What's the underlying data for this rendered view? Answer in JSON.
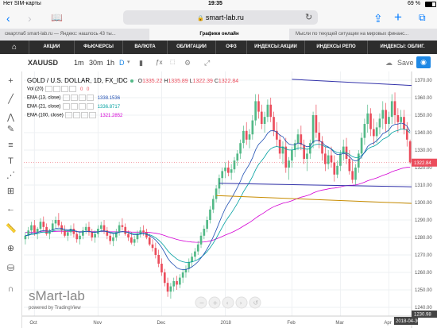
{
  "status": {
    "carrier": "Нет SIM-карты",
    "time": "19:35",
    "battery": "69 %"
  },
  "browser": {
    "url": "smart-lab.ru"
  },
  "tabs": [
    {
      "label": "смартлаб smart-lab.ru — Яндекс: нашлось 43 ты..."
    },
    {
      "label": "Графики онлайн"
    },
    {
      "label": "Мысли по текущей ситуации на мировых финанс..."
    }
  ],
  "site_nav": [
    "АКЦИИ",
    "ФЬЮЧЕРСЫ",
    "ВАЛЮТА",
    "ОБЛИГАЦИИ",
    "ОФЗ",
    "ИНДЕКСЫ:АКЦИИ",
    "ИНДЕКСЫ РЕПО",
    "ИНДЕКСЫ: ОБЛИГ."
  ],
  "toolbar": {
    "symbol": "XAUUSD",
    "intervals": [
      "1m",
      "30m",
      "1h",
      "D"
    ],
    "active_interval": "D",
    "save_label": "Save"
  },
  "legend": {
    "title": "GOLD / U.S. DOLLAR, 1D, FX_IDC",
    "ohlc": {
      "o_label": "O",
      "o": "1335.22",
      "h_label": "H",
      "h": "1335.89",
      "l_label": "L",
      "l": "1322.39",
      "c_label": "C",
      "c": "1322.84"
    },
    "vol": {
      "label": "Vol (20)",
      "v1": "0",
      "v2": "0"
    },
    "ema13": {
      "label": "EMA (13, close)",
      "value": "1338.1536"
    },
    "ema21": {
      "label": "EMA (21, close)",
      "value": "1336.8717"
    },
    "ema100": {
      "label": "EMA (100, close)",
      "value": "1321.2852"
    }
  },
  "colors": {
    "up": "#53b987",
    "down": "#eb4d5c",
    "ema13": "#1f4fb3",
    "ema21": "#00a0a0",
    "ema100": "#d400d4",
    "trend_blue": "#3333aa",
    "trend_orange": "#c88c00"
  },
  "watermark": {
    "logo": "sMart-lab",
    "powered": "powered by TradingView"
  },
  "chart_data": {
    "type": "candlestick",
    "ylim": [
      1235,
      1375
    ],
    "price_ticks": [
      "1370.00",
      "1360.00",
      "1350.00",
      "1340.00",
      "1330.00",
      "1320.00",
      "1310.00",
      "1300.00",
      "1290.00",
      "1280.00",
      "1270.00",
      "1260.00",
      "1250.00",
      "1240.00"
    ],
    "current_price": "1322.84",
    "low_label": "1230.98",
    "x_ticks": [
      "Oct",
      "Nov",
      "Dec",
      "2018",
      "Feb",
      "Mar",
      "Apr"
    ],
    "date_label": "2018-04-30",
    "candles": [
      [
        1279,
        1283,
        1276,
        1281
      ],
      [
        1281,
        1286,
        1279,
        1284
      ],
      [
        1284,
        1289,
        1282,
        1287
      ],
      [
        1287,
        1290,
        1281,
        1283
      ],
      [
        1283,
        1286,
        1279,
        1285
      ],
      [
        1285,
        1291,
        1283,
        1289
      ],
      [
        1289,
        1292,
        1284,
        1286
      ],
      [
        1286,
        1288,
        1281,
        1282
      ],
      [
        1282,
        1285,
        1279,
        1284
      ],
      [
        1284,
        1290,
        1283,
        1288
      ],
      [
        1288,
        1292,
        1285,
        1290
      ],
      [
        1290,
        1294,
        1286,
        1287
      ],
      [
        1287,
        1289,
        1282,
        1284
      ],
      [
        1284,
        1287,
        1280,
        1281
      ],
      [
        1281,
        1284,
        1278,
        1283
      ],
      [
        1283,
        1287,
        1281,
        1285
      ],
      [
        1285,
        1288,
        1280,
        1282
      ],
      [
        1282,
        1284,
        1277,
        1279
      ],
      [
        1279,
        1283,
        1276,
        1281
      ],
      [
        1281,
        1286,
        1279,
        1284
      ],
      [
        1284,
        1288,
        1282,
        1286
      ],
      [
        1286,
        1289,
        1281,
        1283
      ],
      [
        1283,
        1285,
        1278,
        1280
      ],
      [
        1280,
        1284,
        1277,
        1282
      ],
      [
        1282,
        1287,
        1280,
        1285
      ],
      [
        1285,
        1289,
        1283,
        1287
      ],
      [
        1287,
        1290,
        1282,
        1284
      ],
      [
        1284,
        1286,
        1279,
        1281
      ],
      [
        1281,
        1283,
        1276,
        1278
      ],
      [
        1278,
        1282,
        1275,
        1280
      ],
      [
        1280,
        1285,
        1278,
        1283
      ],
      [
        1283,
        1289,
        1281,
        1287
      ],
      [
        1287,
        1291,
        1284,
        1286
      ],
      [
        1286,
        1288,
        1281,
        1282
      ],
      [
        1282,
        1284,
        1278,
        1280
      ],
      [
        1280,
        1283,
        1276,
        1277
      ],
      [
        1277,
        1281,
        1275,
        1279
      ],
      [
        1279,
        1284,
        1277,
        1282
      ],
      [
        1282,
        1286,
        1280,
        1284
      ],
      [
        1284,
        1287,
        1281,
        1283
      ],
      [
        1283,
        1285,
        1279,
        1280
      ],
      [
        1280,
        1282,
        1275,
        1276
      ],
      [
        1276,
        1279,
        1272,
        1274
      ],
      [
        1274,
        1277,
        1268,
        1270
      ],
      [
        1270,
        1273,
        1263,
        1265
      ],
      [
        1265,
        1268,
        1258,
        1260
      ],
      [
        1260,
        1262,
        1252,
        1254
      ],
      [
        1254,
        1257,
        1246,
        1249
      ],
      [
        1249,
        1254,
        1245,
        1252
      ],
      [
        1252,
        1257,
        1249,
        1255
      ],
      [
        1255,
        1258,
        1250,
        1253
      ],
      [
        1253,
        1259,
        1251,
        1257
      ],
      [
        1257,
        1262,
        1254,
        1260
      ],
      [
        1260,
        1264,
        1257,
        1262
      ],
      [
        1262,
        1268,
        1260,
        1266
      ],
      [
        1266,
        1271,
        1263,
        1269
      ],
      [
        1269,
        1274,
        1267,
        1272
      ],
      [
        1272,
        1278,
        1270,
        1276
      ],
      [
        1276,
        1283,
        1274,
        1281
      ],
      [
        1281,
        1287,
        1279,
        1285
      ],
      [
        1285,
        1292,
        1283,
        1290
      ],
      [
        1290,
        1298,
        1288,
        1296
      ],
      [
        1296,
        1304,
        1294,
        1302
      ],
      [
        1302,
        1310,
        1300,
        1308
      ],
      [
        1308,
        1316,
        1305,
        1314
      ],
      [
        1314,
        1320,
        1310,
        1318
      ],
      [
        1318,
        1323,
        1314,
        1320
      ],
      [
        1320,
        1324,
        1315,
        1317
      ],
      [
        1317,
        1322,
        1313,
        1319
      ],
      [
        1319,
        1326,
        1317,
        1324
      ],
      [
        1324,
        1330,
        1321,
        1328
      ],
      [
        1328,
        1336,
        1325,
        1334
      ],
      [
        1334,
        1344,
        1331,
        1341
      ],
      [
        1341,
        1346,
        1333,
        1336
      ],
      [
        1336,
        1342,
        1331,
        1339
      ],
      [
        1339,
        1350,
        1336,
        1347
      ],
      [
        1347,
        1362,
        1344,
        1358
      ],
      [
        1358,
        1362,
        1348,
        1352
      ],
      [
        1352,
        1356,
        1342,
        1345
      ],
      [
        1345,
        1352,
        1340,
        1349
      ],
      [
        1349,
        1359,
        1346,
        1356
      ],
      [
        1356,
        1360,
        1346,
        1349
      ],
      [
        1349,
        1352,
        1338,
        1341
      ],
      [
        1341,
        1346,
        1332,
        1336
      ],
      [
        1336,
        1339,
        1325,
        1328
      ],
      [
        1328,
        1335,
        1322,
        1332
      ],
      [
        1332,
        1337,
        1317,
        1320
      ],
      [
        1320,
        1326,
        1313,
        1324
      ],
      [
        1324,
        1332,
        1320,
        1330
      ],
      [
        1330,
        1336,
        1326,
        1334
      ],
      [
        1334,
        1342,
        1330,
        1339
      ],
      [
        1339,
        1344,
        1330,
        1333
      ],
      [
        1333,
        1336,
        1322,
        1325
      ],
      [
        1325,
        1331,
        1318,
        1328
      ],
      [
        1328,
        1336,
        1325,
        1334
      ],
      [
        1334,
        1352,
        1331,
        1350
      ],
      [
        1350,
        1356,
        1337,
        1340
      ],
      [
        1340,
        1346,
        1331,
        1335
      ],
      [
        1335,
        1338,
        1324,
        1328
      ],
      [
        1328,
        1332,
        1318,
        1322
      ],
      [
        1322,
        1330,
        1319,
        1327
      ],
      [
        1327,
        1332,
        1320,
        1323
      ],
      [
        1323,
        1327,
        1312,
        1316
      ],
      [
        1316,
        1324,
        1314,
        1321
      ],
      [
        1321,
        1330,
        1318,
        1328
      ],
      [
        1328,
        1336,
        1324,
        1332
      ],
      [
        1332,
        1337,
        1322,
        1325
      ],
      [
        1325,
        1330,
        1316,
        1318
      ],
      [
        1318,
        1324,
        1311,
        1313
      ],
      [
        1313,
        1322,
        1310,
        1320
      ],
      [
        1320,
        1330,
        1317,
        1328
      ],
      [
        1328,
        1340,
        1325,
        1337
      ],
      [
        1337,
        1348,
        1333,
        1345
      ],
      [
        1345,
        1356,
        1340,
        1351
      ],
      [
        1351,
        1354,
        1338,
        1342
      ],
      [
        1342,
        1348,
        1333,
        1338
      ],
      [
        1338,
        1346,
        1334,
        1343
      ],
      [
        1343,
        1351,
        1339,
        1348
      ],
      [
        1348,
        1358,
        1342,
        1353
      ],
      [
        1353,
        1357,
        1340,
        1345
      ],
      [
        1345,
        1352,
        1338,
        1349
      ],
      [
        1349,
        1362,
        1345,
        1358
      ],
      [
        1358,
        1363,
        1345,
        1350
      ],
      [
        1350,
        1354,
        1340,
        1346
      ],
      [
        1346,
        1353,
        1342,
        1349
      ],
      [
        1349,
        1353,
        1339,
        1342
      ],
      [
        1342,
        1346,
        1332,
        1336
      ],
      [
        1335,
        1336,
        1322,
        1323
      ]
    ],
    "trend_lines": [
      {
        "color": "blue",
        "from": [
          1319.5,
          1370.5
        ],
        "to": [
          1490,
          1367
        ]
      },
      {
        "color": "blue",
        "from": [
          1293,
          1311
        ],
        "to": [
          1490,
          1309
        ]
      },
      {
        "color": "orange",
        "from": [
          1286,
          1304
        ],
        "to": [
          1490,
          1299.5
        ]
      }
    ]
  }
}
